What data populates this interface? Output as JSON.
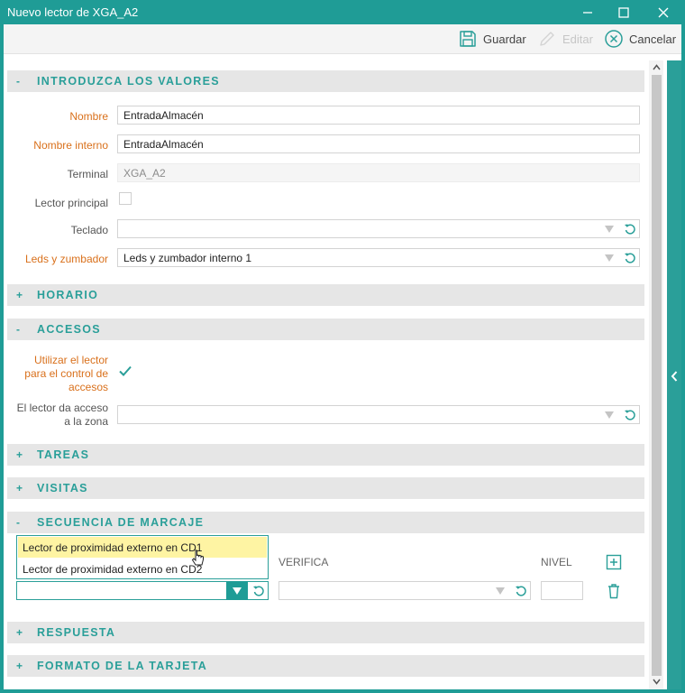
{
  "window": {
    "title": "Nuevo lector de XGA_A2"
  },
  "toolbar": {
    "save_label": "Guardar",
    "edit_label": "Editar",
    "cancel_label": "Cancelar"
  },
  "sections": {
    "valores": {
      "sign": "-",
      "title": "INTRODUZCA LOS VALORES"
    },
    "horario": {
      "sign": "+",
      "title": "HORARIO"
    },
    "accesos": {
      "sign": "-",
      "title": "ACCESOS"
    },
    "tareas": {
      "sign": "+",
      "title": "TAREAS"
    },
    "visitas": {
      "sign": "+",
      "title": "VISITAS"
    },
    "secuencia": {
      "sign": "-",
      "title": "SECUENCIA DE MARCAJE"
    },
    "respuesta": {
      "sign": "+",
      "title": "RESPUESTA"
    },
    "formato": {
      "sign": "+",
      "title": "FORMATO DE LA TARJETA"
    }
  },
  "form": {
    "nombre": {
      "label": "Nombre",
      "value": "EntradaAlmacén"
    },
    "nombre_interno": {
      "label": "Nombre interno",
      "value": "EntradaAlmacén"
    },
    "terminal": {
      "label": "Terminal",
      "value": "XGA_A2"
    },
    "lector_principal": {
      "label": "Lector principal",
      "checked": false
    },
    "teclado": {
      "label": "Teclado",
      "value": ""
    },
    "leds": {
      "label": "Leds y zumbador",
      "value": "Leds y zumbador interno 1"
    }
  },
  "accesos": {
    "utilizar": {
      "label_line1": "Utilizar el lector",
      "label_line2": "para el control de",
      "label_line3": "accesos",
      "checked": true
    },
    "zona": {
      "label_line1": "El lector da acceso",
      "label_line2": "a la zona",
      "value": ""
    }
  },
  "secuencia": {
    "col_verifica": "VERIFICA",
    "col_nivel": "NIVEL",
    "dropdown_options": [
      "Lector de proximidad externo en CD1",
      "Lector de proximidad externo en CD2"
    ],
    "highlighted_index": 0,
    "lector_value": "",
    "verifica_value": "",
    "nivel_value": ""
  },
  "colors": {
    "accent": "#1f9c96",
    "required_label": "#d9701b",
    "highlight": "#fef4a3"
  }
}
